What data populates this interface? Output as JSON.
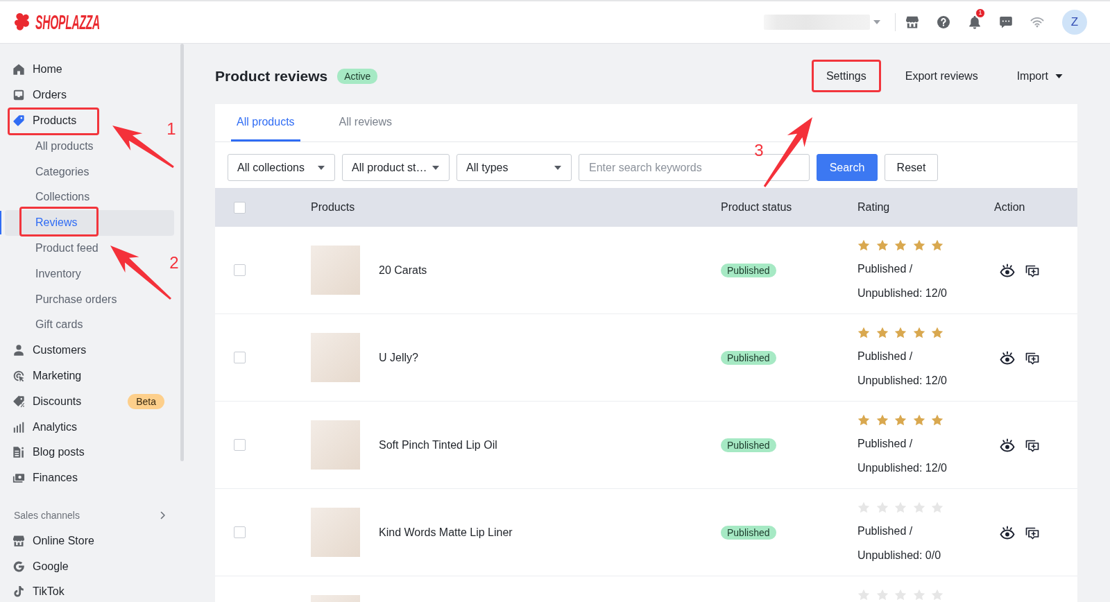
{
  "topbar": {
    "logo": "SHOPLAZZA",
    "notification_count": "1",
    "avatar_initial": "Z"
  },
  "sidebar": {
    "items": [
      {
        "label": "Home",
        "selected": false,
        "annotated": false
      },
      {
        "label": "Orders",
        "selected": false,
        "annotated": false
      },
      {
        "label": "Products",
        "selected": true,
        "annotated": true,
        "children": [
          {
            "label": "All products",
            "selected": false,
            "annotated": false
          },
          {
            "label": "Categories",
            "selected": false,
            "annotated": false
          },
          {
            "label": "Collections",
            "selected": false,
            "annotated": false
          },
          {
            "label": "Reviews",
            "selected": true,
            "annotated": true
          },
          {
            "label": "Product feed",
            "selected": false,
            "annotated": false
          },
          {
            "label": "Inventory",
            "selected": false,
            "annotated": false
          },
          {
            "label": "Purchase orders",
            "selected": false,
            "annotated": false
          },
          {
            "label": "Gift cards",
            "selected": false,
            "annotated": false
          }
        ]
      },
      {
        "label": "Customers",
        "selected": false,
        "annotated": false
      },
      {
        "label": "Marketing",
        "selected": false,
        "annotated": false
      },
      {
        "label": "Discounts",
        "selected": false,
        "annotated": false,
        "badge": "Beta"
      },
      {
        "label": "Analytics",
        "selected": false,
        "annotated": false
      },
      {
        "label": "Blog posts",
        "selected": false,
        "annotated": false
      },
      {
        "label": "Finances",
        "selected": false,
        "annotated": false
      }
    ],
    "section_title": "Sales channels",
    "channels": [
      {
        "label": "Online Store",
        "selected": false
      },
      {
        "label": "Google",
        "selected": false
      },
      {
        "label": "TikTok",
        "selected": false
      }
    ]
  },
  "page": {
    "title": "Product reviews",
    "status": "Active",
    "actions": [
      {
        "label": "Settings",
        "kind": "button",
        "annotated": true
      },
      {
        "label": "Export reviews",
        "kind": "button",
        "annotated": false
      },
      {
        "label": "Import",
        "kind": "dropdown",
        "annotated": false
      }
    ]
  },
  "tabs": [
    {
      "label": "All products",
      "selected": true
    },
    {
      "label": "All reviews",
      "selected": false
    }
  ],
  "filters": {
    "dropdowns": [
      {
        "value": "All collections"
      },
      {
        "value": "All product st…"
      },
      {
        "value": "All types"
      }
    ],
    "search": {
      "placeholder": "Enter search keywords"
    },
    "buttons": [
      {
        "label": "Search",
        "kind": "primary"
      },
      {
        "label": "Reset",
        "kind": "secondary"
      }
    ]
  },
  "table": {
    "select_all": {
      "checked": false
    },
    "columns": [
      {
        "label": "Products"
      },
      {
        "label": "Product status"
      },
      {
        "label": "Rating"
      },
      {
        "label": "Action"
      }
    ],
    "rows": [
      {
        "checked": false,
        "name": "20 Carats",
        "status": "Published",
        "stars": 5,
        "counts": "Published / Unpublished: 12/0"
      },
      {
        "checked": false,
        "name": "U Jelly?",
        "status": "Published",
        "stars": 5,
        "counts": "Published / Unpublished: 12/0"
      },
      {
        "checked": false,
        "name": "Soft Pinch Tinted Lip Oil",
        "status": "Published",
        "stars": 5,
        "counts": "Published / Unpublished: 12/0"
      },
      {
        "checked": false,
        "name": "Kind Words Matte Lip Liner",
        "status": "Published",
        "stars": 0,
        "counts": "Published / Unpublished: 0/0"
      },
      {
        "stars": 0
      }
    ]
  },
  "annotations": [
    {
      "label": "1"
    },
    {
      "label": "2"
    },
    {
      "label": "3"
    }
  ]
}
